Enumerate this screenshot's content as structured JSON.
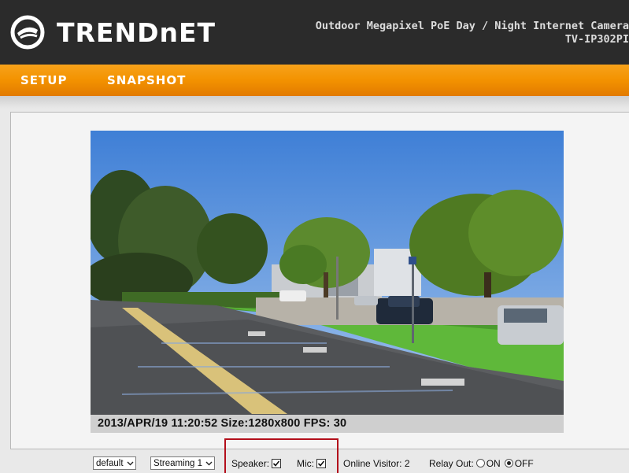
{
  "header": {
    "brand": "TRENDnET",
    "product_line1": "Outdoor Megapixel PoE Day / Night Internet Camera",
    "product_line2": "TV-IP302PI"
  },
  "nav": {
    "items": [
      {
        "label": "SETUP"
      },
      {
        "label": "SNAPSHOT"
      }
    ]
  },
  "video": {
    "osd_text": "2013/APR/19 11:20:52 Size:1280x800 FPS: 30"
  },
  "controls": {
    "profile_select": "default",
    "stream_select": "Streaming 1",
    "speaker_label": "Speaker:",
    "speaker_checked": true,
    "mic_label": "Mic:",
    "mic_checked": true,
    "online_visitor_label": "Online Visitor: 2",
    "relay_out_label": "Relay Out:",
    "relay_on_label": "ON",
    "relay_off_label": "OFF",
    "relay_selected": "OFF"
  },
  "colors": {
    "header_bg": "#2b2b2b",
    "nav_orange": "#f39200",
    "highlight_red": "#b30f1b"
  }
}
